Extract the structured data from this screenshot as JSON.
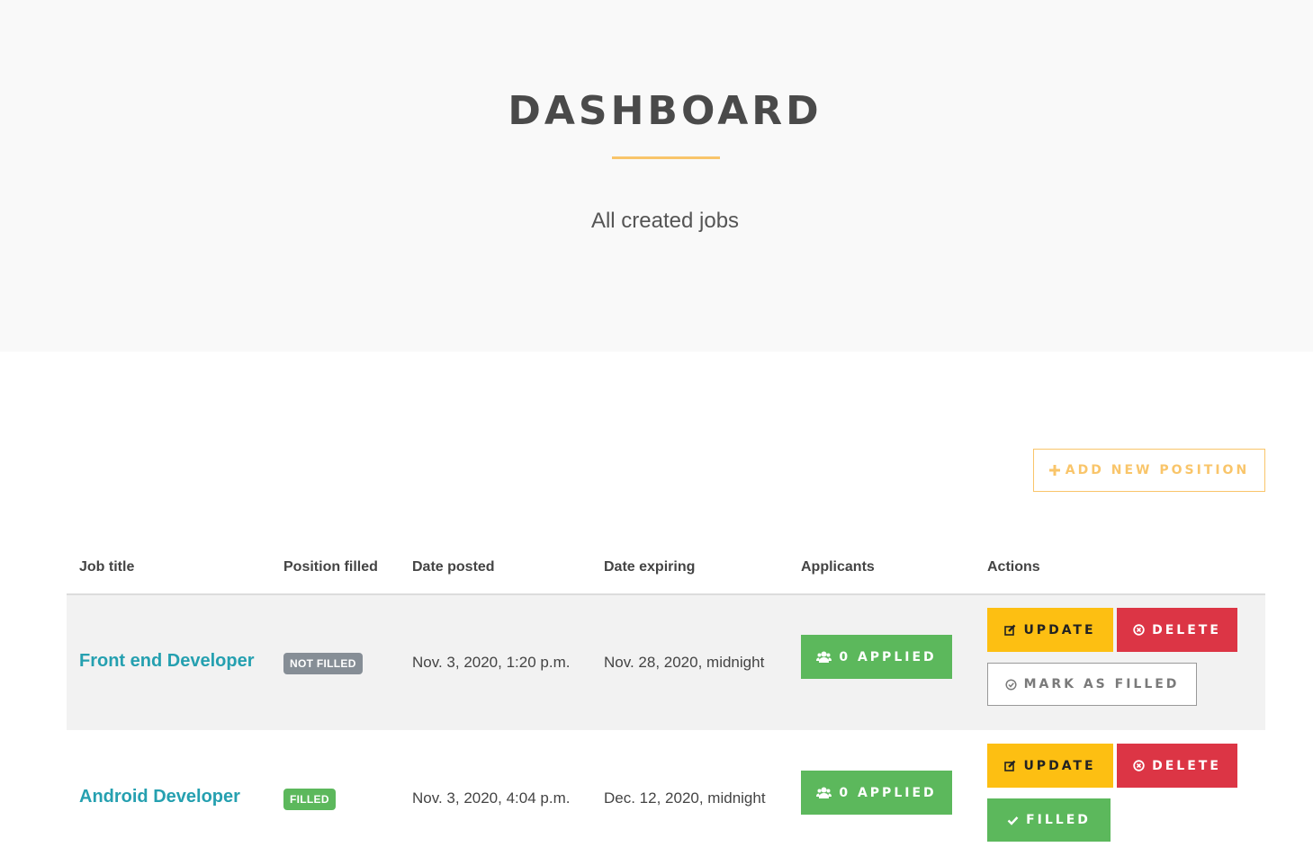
{
  "hero": {
    "title": "DASHBOARD",
    "subtitle": "All created jobs"
  },
  "add_position": {
    "icon": "plus-icon",
    "label": "ADD NEW POSITION",
    "color": "#f9c56a"
  },
  "table": {
    "headers": {
      "job_title": "Job title",
      "position_filled": "Position filled",
      "date_posted": "Date posted",
      "date_expiring": "Date expiring",
      "applicants": "Applicants",
      "actions": "Actions"
    },
    "rows": [
      {
        "job_title": "Front end Developer",
        "status": "NOT FILLED",
        "status_color": "#868e96",
        "date_posted": "Nov. 3, 2020, 1:20 p.m.",
        "date_expiring": "Nov. 28, 2020, midnight",
        "applicants": "0 APPLIED",
        "update": "UPDATE",
        "delete": "DELETE",
        "fill_action": "MARK AS FILLED"
      },
      {
        "job_title": "Android Developer",
        "status": "FILLED",
        "status_color": "#5cb85c",
        "date_posted": "Nov. 3, 2020, 4:04 p.m.",
        "date_expiring": "Dec. 12, 2020, midnight",
        "applicants": "0 APPLIED",
        "update": "UPDATE",
        "delete": "DELETE",
        "fill_action": "FILLED"
      }
    ]
  },
  "colors": {
    "link": "#25a0b0",
    "update": "#fdbf12",
    "delete": "#dc3545",
    "success": "#5cb85c",
    "accent": "#f9c56a"
  },
  "icons": {
    "applicants": "users-icon",
    "update": "edit-icon",
    "delete": "times-circle-icon",
    "mark_filled": "check-circle-icon",
    "filled": "check-icon"
  }
}
